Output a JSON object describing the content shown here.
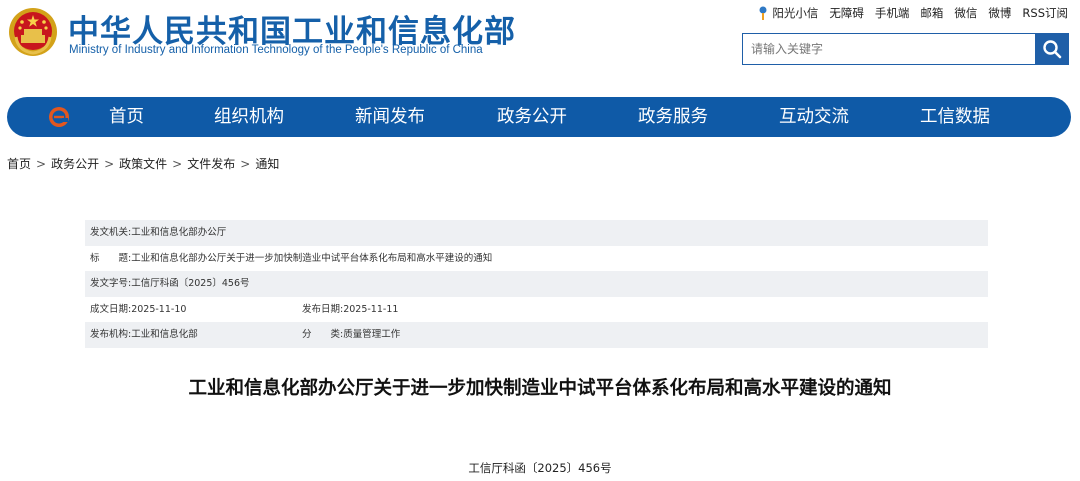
{
  "header": {
    "title": "中华人民共和国工业和信息化部",
    "subtitle": "Ministry of Industry and Information Technology of the People's Republic of China",
    "brand_color": "#1560a9"
  },
  "toplinks": [
    "阳光小信",
    "无障碍",
    "手机端",
    "邮箱",
    "微信",
    "微博",
    "RSS订阅"
  ],
  "search": {
    "placeholder": "请输入关键字",
    "icon": "search-icon"
  },
  "nav": {
    "color": "#0f5aa7",
    "logo_icon": "e-logo-icon",
    "items": [
      "首页",
      "组织机构",
      "新闻发布",
      "政务公开",
      "政务服务",
      "互动交流",
      "工信数据"
    ]
  },
  "breadcrumb": [
    "首页",
    "政务公开",
    "政策文件",
    "文件发布",
    "通知"
  ],
  "info": {
    "issuer_label": "发文机关:",
    "issuer": "工业和信息化部办公厅",
    "title_label": "标　　题:",
    "title": "工业和信息化部办公厅关于进一步加快制造业中试平台体系化布局和高水平建设的通知",
    "docno_label": "发文字号:",
    "docno": "工信厅科函〔2025〕456号",
    "written_label": "成文日期:",
    "written": "2025-11-10",
    "published_label": "发布日期:",
    "published": "2025-11-11",
    "org_label": "发布机构:",
    "org": "工业和信息化部",
    "category_label": "分　　类:",
    "category": "质量管理工作"
  },
  "article": {
    "title": "工业和信息化部办公厅关于进一步加快制造业中试平台体系化布局和高水平建设的通知",
    "doc_number": "工信厅科函〔2025〕456号"
  }
}
